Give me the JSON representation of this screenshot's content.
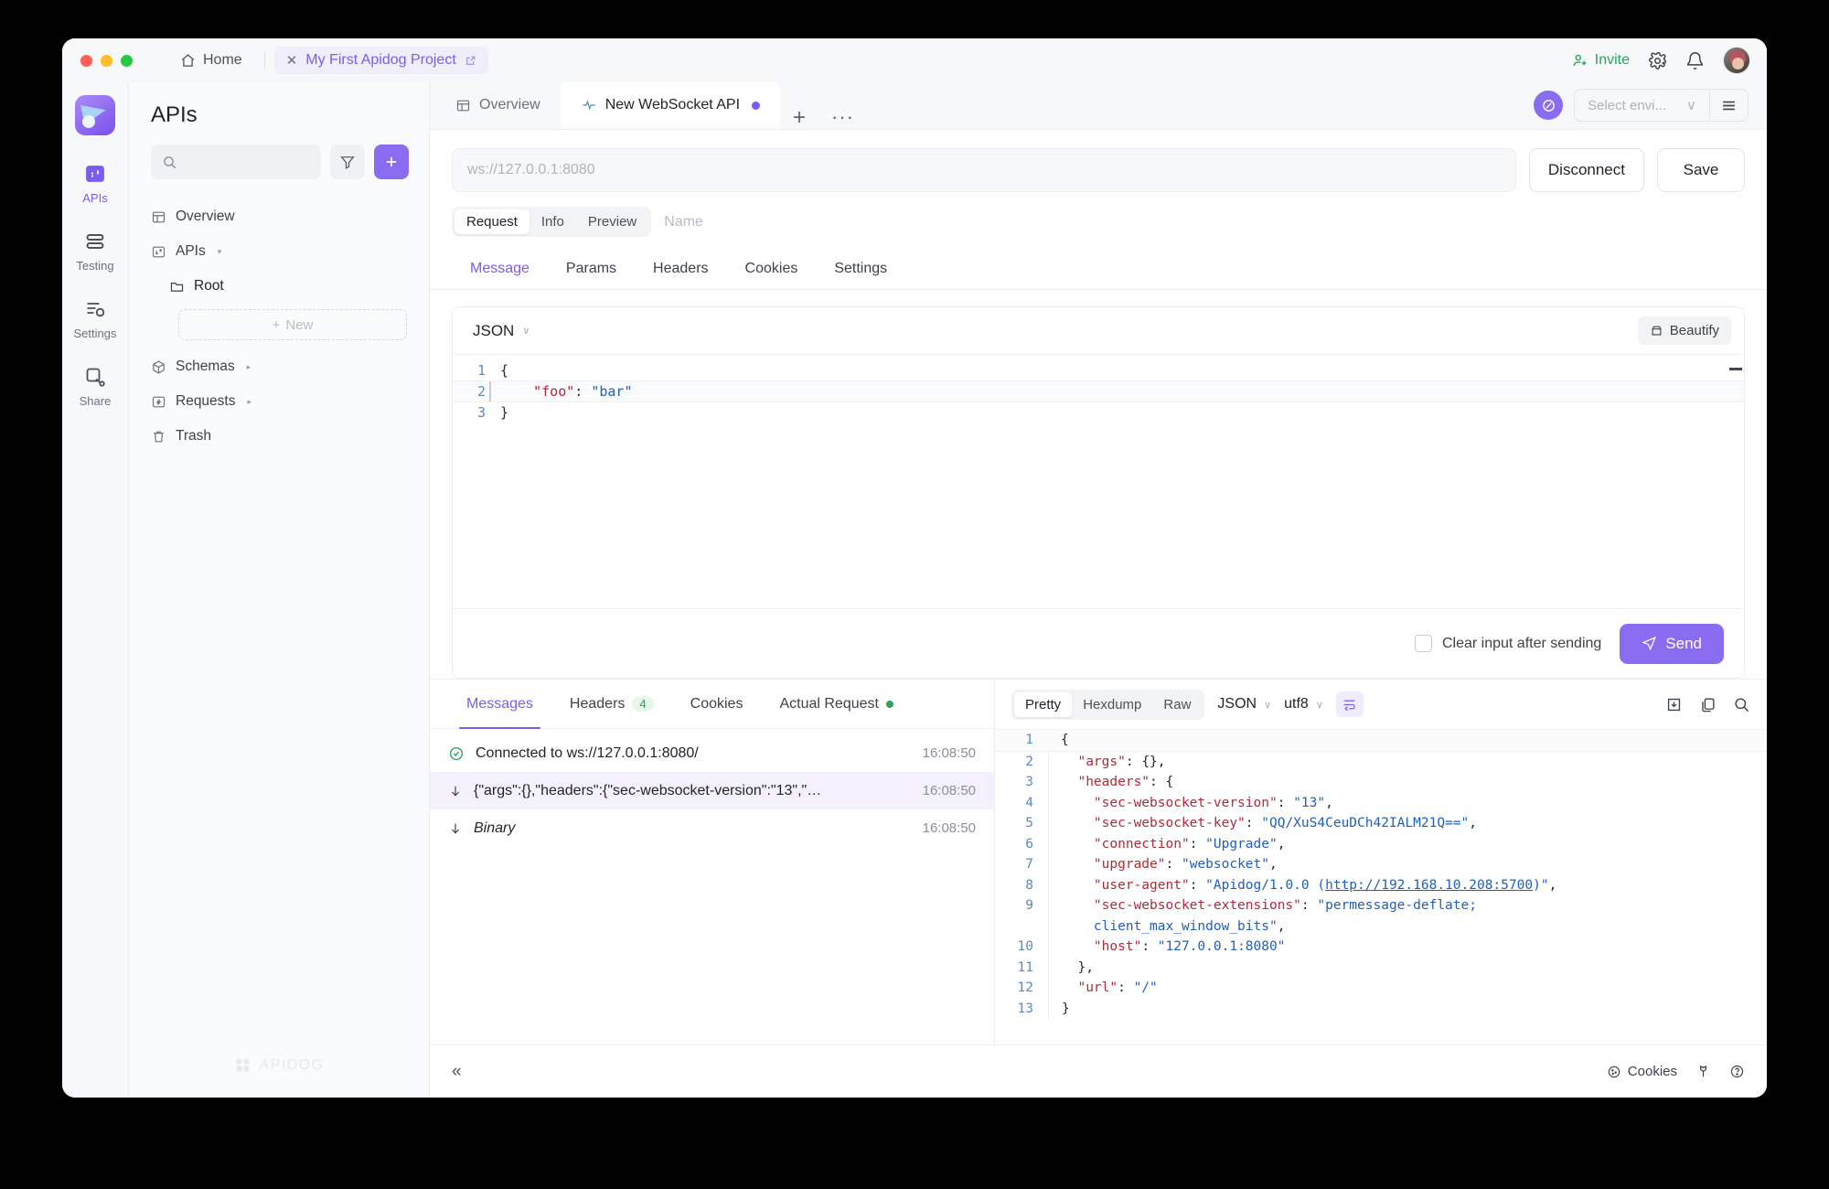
{
  "titlebar": {
    "home_label": "Home",
    "project_tab": "My First Apidog Project",
    "invite_label": "Invite",
    "icons": {
      "home": "home-icon",
      "close": "close-icon",
      "external": "external-link-icon",
      "gear": "gear-icon",
      "bell": "bell-icon"
    }
  },
  "rail": {
    "items": [
      {
        "label": "APIs",
        "icon": "apis-icon",
        "active": true
      },
      {
        "label": "Testing",
        "icon": "testing-icon",
        "active": false
      },
      {
        "label": "Settings",
        "icon": "settings-icon",
        "active": false
      },
      {
        "label": "Share",
        "icon": "share-icon",
        "active": false
      }
    ]
  },
  "sidebar": {
    "title": "APIs",
    "search_placeholder": "",
    "filter_icon": "filter-icon",
    "add_icon": "plus-icon",
    "tree": [
      {
        "label": "Overview",
        "icon": "overview-icon",
        "caret": ""
      },
      {
        "label": "APIs",
        "icon": "apis-icon",
        "caret": "▾"
      },
      {
        "label": "Root",
        "icon": "folder-icon",
        "caret": "",
        "indent": true
      },
      {
        "label": "Schemas",
        "icon": "schema-icon",
        "caret": "▸"
      },
      {
        "label": "Requests",
        "icon": "requests-icon",
        "caret": "▸"
      },
      {
        "label": "Trash",
        "icon": "trash-icon",
        "caret": ""
      }
    ],
    "new_label": "New",
    "watermark": "APIDOG"
  },
  "maintabs": {
    "overview_label": "Overview",
    "socket_label": "New WebSocket API",
    "plus_label": "+",
    "more_label": "···",
    "env_placeholder": "Select envi...",
    "env_caret": "∨"
  },
  "urlbar": {
    "placeholder": "ws://127.0.0.1:8080",
    "value": "",
    "disconnect_label": "Disconnect",
    "save_label": "Save"
  },
  "segmented": {
    "items": [
      "Request",
      "Info",
      "Preview"
    ],
    "active": "Request",
    "name_placeholder": "Name"
  },
  "subtabs": {
    "items": [
      "Message",
      "Params",
      "Headers",
      "Cookies",
      "Settings"
    ],
    "active": "Message"
  },
  "editor": {
    "format": "JSON",
    "format_caret": "∨",
    "beautify_label": "Beautify",
    "lines": [
      {
        "n": "1",
        "segs": [
          {
            "t": "{",
            "c": "p"
          }
        ]
      },
      {
        "n": "2",
        "hl": true,
        "segs": [
          {
            "t": "    ",
            "c": "p"
          },
          {
            "t": "\"foo\"",
            "c": "k"
          },
          {
            "t": ": ",
            "c": "p"
          },
          {
            "t": "\"bar\"",
            "c": "v"
          }
        ]
      },
      {
        "n": "3",
        "segs": [
          {
            "t": "}",
            "c": "p"
          }
        ]
      }
    ],
    "clear_label": "Clear input after sending",
    "send_label": "Send"
  },
  "bottom_left": {
    "tabs": [
      {
        "label": "Messages",
        "active": true
      },
      {
        "label": "Headers",
        "badge": "4"
      },
      {
        "label": "Cookies"
      },
      {
        "label": "Actual Request",
        "dot": true
      }
    ],
    "messages": [
      {
        "icon": "check-circle-icon",
        "text": "Connected to ws://127.0.0.1:8080/",
        "time": "16:08:50",
        "selected": false,
        "italic": false
      },
      {
        "icon": "arrow-down-icon",
        "text": "{\"args\":{},\"headers\":{\"sec-websocket-version\":\"13\",\"…",
        "time": "16:08:50",
        "selected": true,
        "italic": false
      },
      {
        "icon": "arrow-down-icon",
        "text": "Binary",
        "time": "16:08:50",
        "selected": false,
        "italic": true
      }
    ]
  },
  "response": {
    "view_modes": [
      "Pretty",
      "Hexdump",
      "Raw"
    ],
    "view_active": "Pretty",
    "format": "JSON",
    "encoding": "utf8",
    "caret": "∨",
    "wrap_icon": "word-wrap-icon",
    "save_icon": "download-icon",
    "copy_icon": "copy-icon",
    "search_icon": "search-icon",
    "lines": [
      {
        "n": "1",
        "first": true,
        "segs": [
          {
            "t": "{",
            "c": "p"
          }
        ]
      },
      {
        "n": "2",
        "segs": [
          {
            "t": "  ",
            "c": "p"
          },
          {
            "t": "\"args\"",
            "c": "k"
          },
          {
            "t": ": {},",
            "c": "p"
          }
        ]
      },
      {
        "n": "3",
        "segs": [
          {
            "t": "  ",
            "c": "p"
          },
          {
            "t": "\"headers\"",
            "c": "k"
          },
          {
            "t": ": {",
            "c": "p"
          }
        ]
      },
      {
        "n": "4",
        "segs": [
          {
            "t": "    ",
            "c": "p"
          },
          {
            "t": "\"sec-websocket-version\"",
            "c": "k"
          },
          {
            "t": ": ",
            "c": "p"
          },
          {
            "t": "\"13\"",
            "c": "v"
          },
          {
            "t": ",",
            "c": "p"
          }
        ]
      },
      {
        "n": "5",
        "segs": [
          {
            "t": "    ",
            "c": "p"
          },
          {
            "t": "\"sec-websocket-key\"",
            "c": "k"
          },
          {
            "t": ": ",
            "c": "p"
          },
          {
            "t": "\"QQ/XuS4CeuDCh42IALM21Q==\"",
            "c": "v"
          },
          {
            "t": ",",
            "c": "p"
          }
        ]
      },
      {
        "n": "6",
        "segs": [
          {
            "t": "    ",
            "c": "p"
          },
          {
            "t": "\"connection\"",
            "c": "k"
          },
          {
            "t": ": ",
            "c": "p"
          },
          {
            "t": "\"Upgrade\"",
            "c": "v"
          },
          {
            "t": ",",
            "c": "p"
          }
        ]
      },
      {
        "n": "7",
        "segs": [
          {
            "t": "    ",
            "c": "p"
          },
          {
            "t": "\"upgrade\"",
            "c": "k"
          },
          {
            "t": ": ",
            "c": "p"
          },
          {
            "t": "\"websocket\"",
            "c": "v"
          },
          {
            "t": ",",
            "c": "p"
          }
        ]
      },
      {
        "n": "8",
        "segs": [
          {
            "t": "    ",
            "c": "p"
          },
          {
            "t": "\"user-agent\"",
            "c": "k"
          },
          {
            "t": ": ",
            "c": "p"
          },
          {
            "t": "\"Apidog/1.0.0 (",
            "c": "v"
          },
          {
            "t": "http://192.168.10.208:5700",
            "c": "u"
          },
          {
            "t": ")\"",
            "c": "v"
          },
          {
            "t": ",",
            "c": "p"
          }
        ]
      },
      {
        "n": "9",
        "segs": [
          {
            "t": "    ",
            "c": "p"
          },
          {
            "t": "\"sec-websocket-extensions\"",
            "c": "k"
          },
          {
            "t": ": ",
            "c": "p"
          },
          {
            "t": "\"permessage-deflate;",
            "c": "v"
          }
        ]
      },
      {
        "n": "",
        "segs": [
          {
            "t": "    ",
            "c": "p"
          },
          {
            "t": "client_max_window_bits\"",
            "c": "v"
          },
          {
            "t": ",",
            "c": "p"
          }
        ]
      },
      {
        "n": "10",
        "segs": [
          {
            "t": "    ",
            "c": "p"
          },
          {
            "t": "\"host\"",
            "c": "k"
          },
          {
            "t": ": ",
            "c": "p"
          },
          {
            "t": "\"127.0.0.1:8080\"",
            "c": "v"
          }
        ]
      },
      {
        "n": "11",
        "segs": [
          {
            "t": "  },",
            "c": "p"
          }
        ]
      },
      {
        "n": "12",
        "segs": [
          {
            "t": "  ",
            "c": "p"
          },
          {
            "t": "\"url\"",
            "c": "k"
          },
          {
            "t": ": ",
            "c": "p"
          },
          {
            "t": "\"/\"",
            "c": "v"
          }
        ]
      },
      {
        "n": "13",
        "segs": [
          {
            "t": "}",
            "c": "p"
          }
        ]
      }
    ]
  },
  "statusbar": {
    "collapse": "«",
    "cookies_label": "Cookies",
    "cookie_icon": "cookie-icon",
    "wrench_icon": "wrench-icon",
    "help_icon": "help-icon"
  },
  "colors": {
    "accent": "#7c5cf0",
    "accent_button": "#8a6cf1",
    "green": "#2aa458",
    "json_key": "#b02a37",
    "json_value": "#1f5fbf",
    "line_number": "#5b8ac7"
  }
}
